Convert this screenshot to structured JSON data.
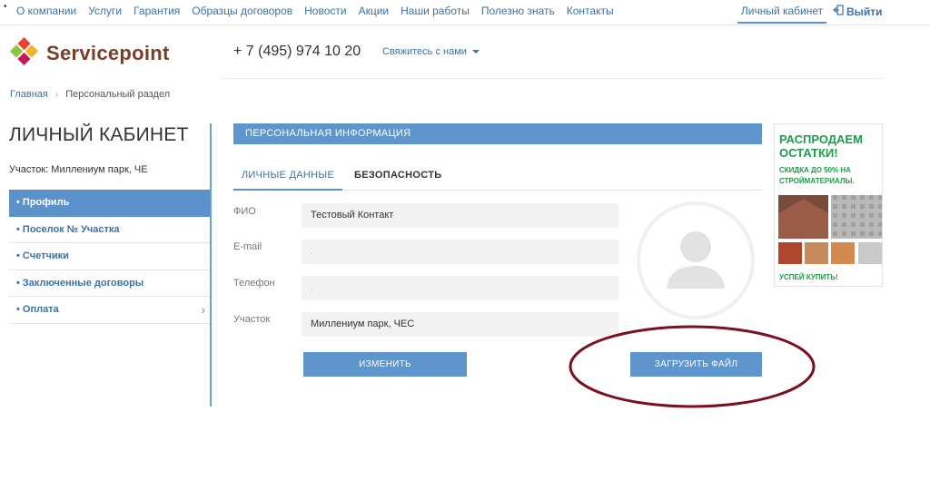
{
  "topnav": {
    "items": [
      "О компании",
      "Услуги",
      "Гарантия",
      "Образцы договоров",
      "Новости",
      "Акции",
      "Наши работы",
      "Полезно знать",
      "Контакты"
    ],
    "cabinet": "Личный кабинет",
    "logout": "Выйти"
  },
  "header": {
    "logo_text": "Servicepoint",
    "phone": "+ 7 (495) 974 10 20",
    "contact": "Свяжитесь с нами"
  },
  "breadcrumb": {
    "home": "Главная",
    "separator": "›",
    "current": "Персональный раздел"
  },
  "sidebar": {
    "title": "ЛИЧНЫЙ КАБИНЕТ",
    "plot": "Участок: Миллениум парк, ЧЕ",
    "items": [
      {
        "label": "• Профиль",
        "active": true
      },
      {
        "label": "• Поселок № Участка",
        "active": false
      },
      {
        "label": "• Счетчики",
        "active": false
      },
      {
        "label": "• Заключенные договоры",
        "active": false
      },
      {
        "label": "• Оплата",
        "active": false,
        "chevron": "›"
      }
    ]
  },
  "main": {
    "section_title": "ПЕРСОНАЛЬНАЯ ИНФОРМАЦИЯ",
    "tabs": [
      "ЛИЧНЫЕ ДАННЫЕ",
      "БЕЗОПАСНОСТЬ"
    ],
    "fields": [
      {
        "label": "ФИО",
        "value": "Тестовый Контакт"
      },
      {
        "label": "E-mail",
        "value": "."
      },
      {
        "label": "Телефон",
        "value": "."
      },
      {
        "label": "Участок",
        "value": "Миллениум парк, ЧЕС"
      }
    ],
    "edit_button": "ИЗМЕНИТЬ",
    "upload_button": "ЗАГРУЗИТЬ ФАЙЛ"
  },
  "ad": {
    "headline": "РАСПРОДАЕМ ОСТАТКИ!",
    "sub": "СКИДКА ДО 50% НА СТРОЙМАТЕРИАЛЫ.",
    "cta": "УСПЕЙ КУПИТЬ!"
  },
  "colors": {
    "accent": "#5e95cc",
    "link": "#3b72a8",
    "brand": "#7a3e26",
    "ad_green": "#1f9b4a",
    "annotation": "#7a1020"
  }
}
